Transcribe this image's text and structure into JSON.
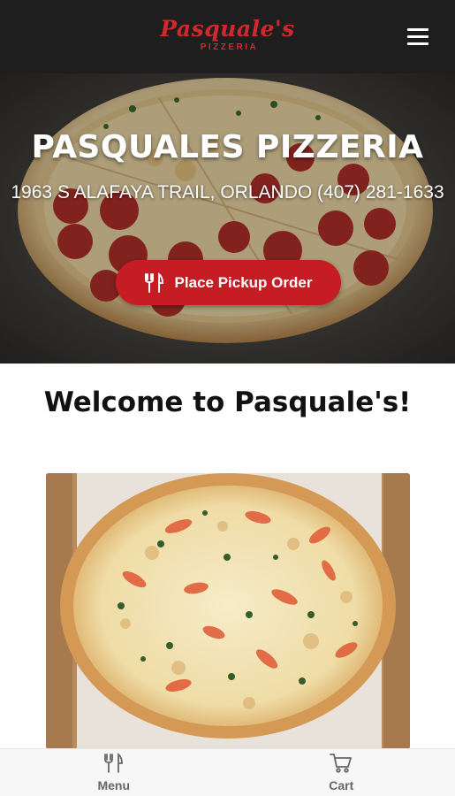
{
  "header": {
    "logo_script": "Pasquale's",
    "logo_sub": "PIZZERIA",
    "menu_icon": "hamburger-menu-icon",
    "background_color": "#1e1e1e",
    "brand_color": "#d0282c"
  },
  "hero": {
    "title": "PASQUALES PIZZERIA",
    "address": "1963 S ALAFAYA TRAIL, ORLANDO (407) 281-1633",
    "order_button": {
      "label": "Place Pickup Order",
      "icon": "fork-knife-icon",
      "color": "#c61c23"
    }
  },
  "welcome": {
    "heading": "Welcome to Pasquale's!"
  },
  "bottom_nav": {
    "items": [
      {
        "label": "Menu",
        "icon": "fork-knife-icon"
      },
      {
        "label": "Cart",
        "icon": "cart-icon"
      }
    ]
  }
}
